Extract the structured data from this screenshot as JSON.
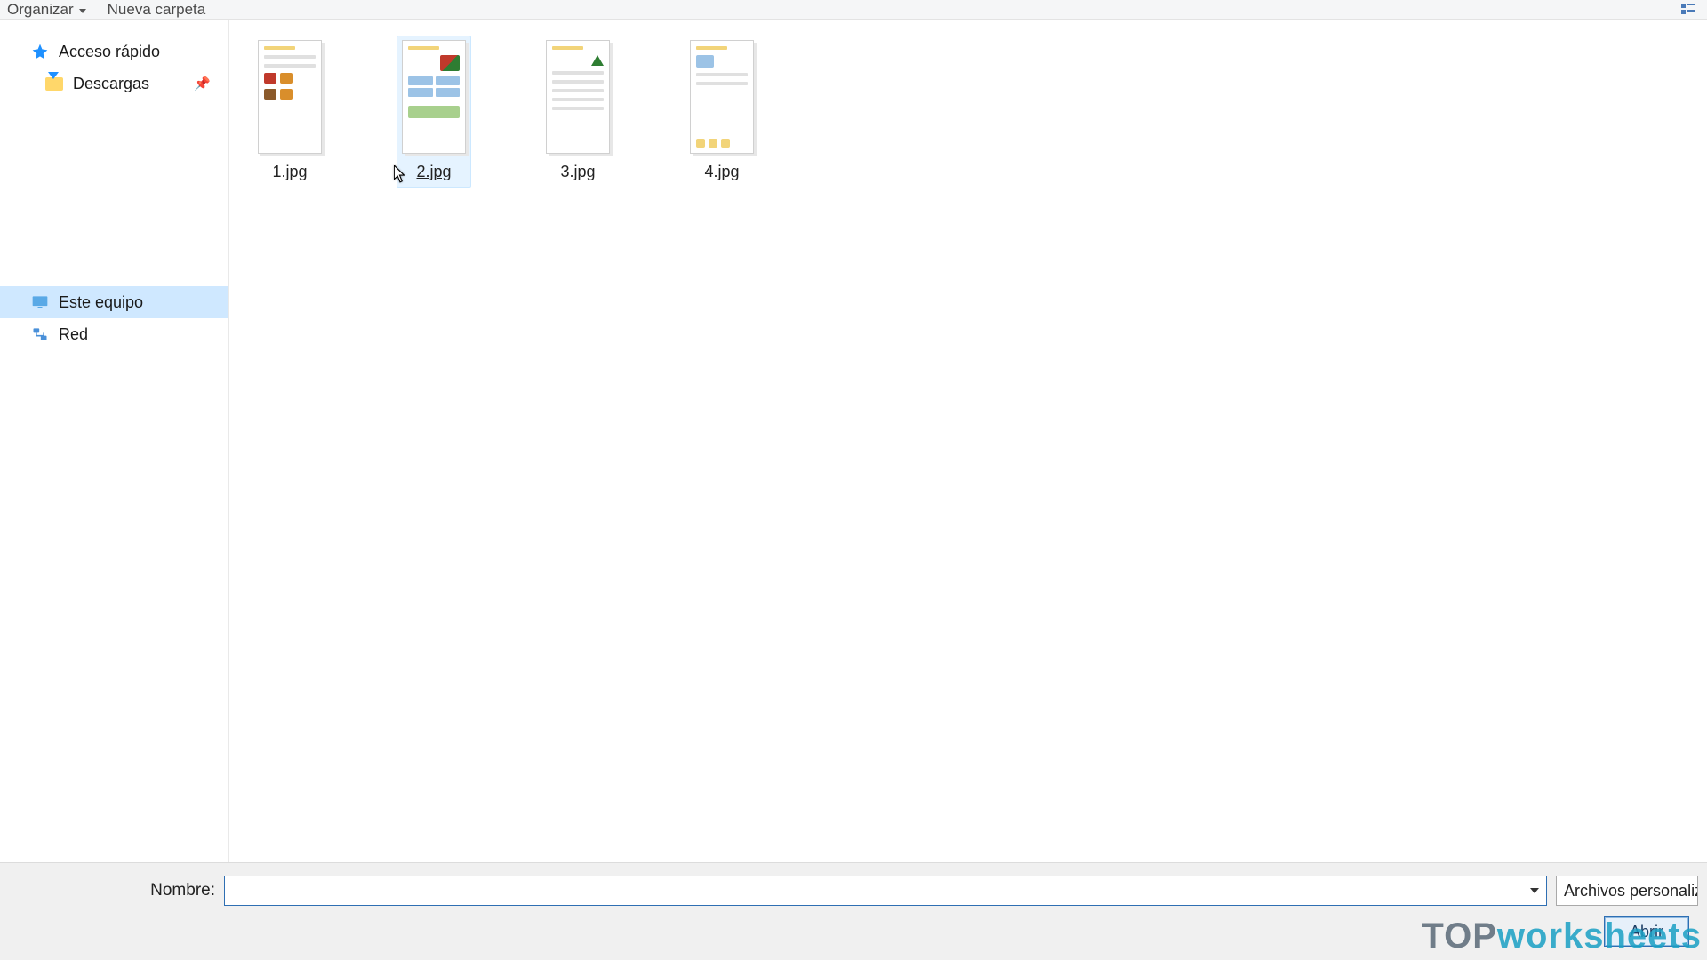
{
  "toolbar": {
    "organize_label": "Organizar",
    "newfolder_label": "Nueva carpeta"
  },
  "nav": {
    "quick_access": "Acceso rápido",
    "downloads": "Descargas",
    "this_pc": "Este equipo",
    "network": "Red"
  },
  "files": [
    {
      "name": "1.jpg",
      "hover": false
    },
    {
      "name": "2.jpg",
      "hover": true
    },
    {
      "name": "3.jpg",
      "hover": false
    },
    {
      "name": "4.jpg",
      "hover": false
    }
  ],
  "bottom": {
    "name_label": "Nombre:",
    "name_value": "",
    "filter_label": "Archivos personaliz",
    "open_label": "Abrir"
  },
  "watermark": {
    "a": "TOP",
    "b": "worksheets"
  }
}
